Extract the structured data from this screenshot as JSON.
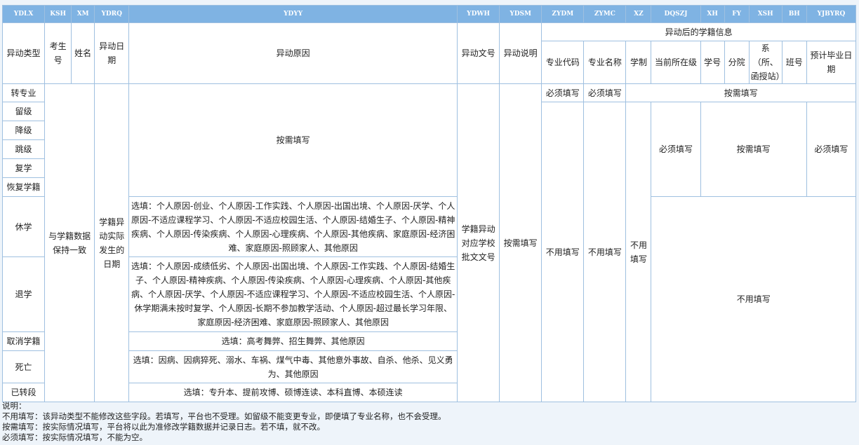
{
  "codes": [
    "YDLX",
    "KSH",
    "XM",
    "YDRQ",
    "YDYY",
    "YDWH",
    "YDSM",
    "ZYDM",
    "ZYMC",
    "XZ",
    "DQSZJ",
    "XH",
    "FY",
    "XSH",
    "BH",
    "YJBYRQ"
  ],
  "headers": {
    "ydlx": "异动类型",
    "ksh": "考生号",
    "xm": "姓名",
    "ydrq": "异动日期",
    "ydyy": "异动原因",
    "ydwh": "异动文号",
    "ydsm": "异动说明",
    "group": "异动后的学籍信息",
    "zydm": "专业代码",
    "zymc": "专业名称",
    "xz": "学制",
    "dqszj": "当前所在级",
    "xh": "学号",
    "fy": "分院",
    "xsh": "系（所、函授站）",
    "bh": "班号",
    "yjbyrq": "预计毕业日期"
  },
  "types": [
    "转专业",
    "留级",
    "降级",
    "跳级",
    "复学",
    "恢复学籍",
    "休学",
    "退学",
    "取消学籍",
    "死亡",
    "已转段"
  ],
  "cells": {
    "ksh_xm": "与学籍数据保持一致",
    "ydrq": "学籍异动实际发生的日期",
    "ydyy_top": "按需填写",
    "ydyy_xiuxue": "选填：个人原因-创业、个人原因-工作实践、个人原因-出国出境、个人原因-厌学、个人原因-不适应课程学习、个人原因-不适应校园生活、个人原因-结婚生子、个人原因-精神疾病、个人原因-传染疾病、个人原因-心理疾病、个人原因-其他疾病、家庭原因-经济困难、家庭原因-照顾家人、其他原因",
    "ydyy_tuixue": "选填：个人原因-成绩低劣、个人原因-出国出境、个人原因-工作实践、个人原因-结婚生子、个人原因-精神疾病、个人原因-传染疾病、个人原因-心理疾病、个人原因-其他疾病、个人原因-厌学、个人原因-不适应课程学习、个人原因-不适应校园生活、个人原因-休学期满未按时复学、个人原因-长期不参加教学活动、个人原因-超过最长学习年限、家庭原因-经济困难、家庭原因-照顾家人、其他原因",
    "ydyy_quxiao": "选填：高考舞弊、招生舞弊、其他原因",
    "ydyy_siwang": "选填：因病、因病猝死、溺水、车祸、煤气中毒、其他意外事故、自杀、他杀、见义勇为、其他原因",
    "ydyy_zhuanduan": "选填：专升本、提前攻博、硕博连读、本科直博、本硕连读",
    "ydwh": "学籍异动对应学校批文文号",
    "ydsm": "按需填写",
    "must": "必须填写",
    "asneed": "按需填写",
    "notneed": "不用填写"
  },
  "notes": [
    "说明：",
    "不用填写：该异动类型不能修改这些字段。若填写，平台也不受理。如留级不能变更专业，即便填了专业名称，也不会受理。",
    "按需填写：按实际情况填写，平台将以此为准修改学籍数据并记录日志。若不填，就不改。",
    "必须填写：按实际情况填写，不能为空。"
  ]
}
